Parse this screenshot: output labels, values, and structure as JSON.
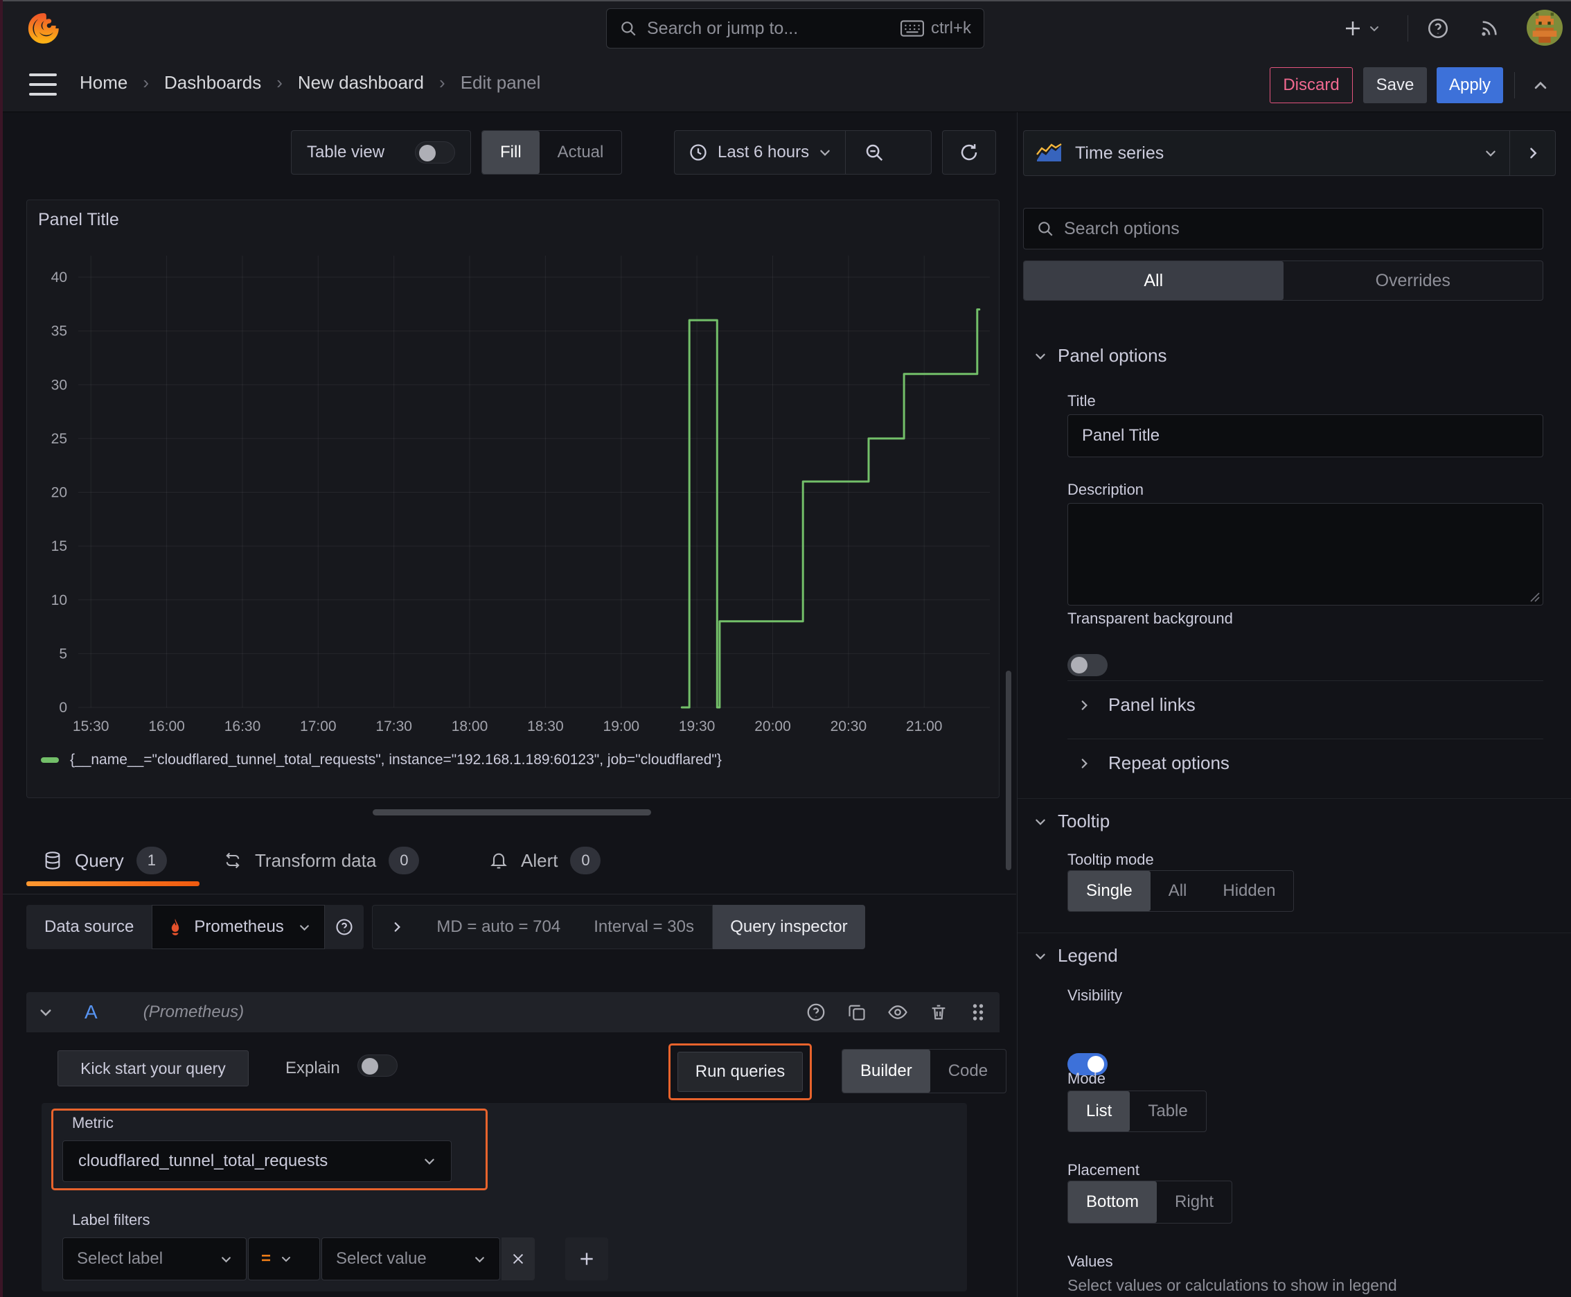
{
  "header": {
    "search_placeholder": "Search or jump to...",
    "search_shortcut": "ctrl+k"
  },
  "breadcrumb": {
    "items": [
      "Home",
      "Dashboards",
      "New dashboard"
    ],
    "current": "Edit panel",
    "discard": "Discard",
    "save": "Save",
    "apply": "Apply"
  },
  "toolbar": {
    "table_view": "Table view",
    "fill": "Fill",
    "actual": "Actual",
    "time_range": "Last 6 hours"
  },
  "panel": {
    "title": "Panel Title",
    "legend_label": "{__name__=\"cloudflared_tunnel_total_requests\", instance=\"192.168.1.189:60123\", job=\"cloudflared\"}"
  },
  "chart_data": {
    "type": "line",
    "line_style": "step-after",
    "title": "Panel Title",
    "x_ticks": [
      "15:30",
      "16:00",
      "16:30",
      "17:00",
      "17:30",
      "18:00",
      "18:30",
      "19:00",
      "19:30",
      "20:00",
      "20:30",
      "21:00"
    ],
    "y_ticks": [
      0,
      5,
      10,
      15,
      20,
      25,
      30,
      35,
      40
    ],
    "ylim": [
      0,
      42
    ],
    "x_range": [
      "15:25",
      "21:26"
    ],
    "grid": true,
    "legend_position": "bottom",
    "series": [
      {
        "name": "{__name__=\"cloudflared_tunnel_total_requests\", instance=\"192.168.1.189:60123\", job=\"cloudflared\"}",
        "color": "#73bf69",
        "points": [
          [
            "19:24",
            0
          ],
          [
            "19:27",
            36
          ],
          [
            "19:38",
            0
          ],
          [
            "19:39",
            8
          ],
          [
            "20:12",
            21
          ],
          [
            "20:38",
            25
          ],
          [
            "20:52",
            31
          ],
          [
            "21:21",
            37
          ]
        ]
      }
    ]
  },
  "tabs": {
    "query": "Query",
    "query_count": "1",
    "transform": "Transform data",
    "transform_count": "0",
    "alert": "Alert",
    "alert_count": "0"
  },
  "datasource": {
    "label": "Data source",
    "name": "Prometheus",
    "stats_md": "MD = auto = 704",
    "stats_interval": "Interval = 30s",
    "inspector": "Query inspector"
  },
  "query": {
    "ref_id": "A",
    "ds_hint": "(Prometheus)",
    "kickstart": "Kick start your query",
    "explain": "Explain",
    "run": "Run queries",
    "builder": "Builder",
    "code": "Code",
    "metric_label": "Metric",
    "metric_value": "cloudflared_tunnel_total_requests",
    "label_filters_label": "Label filters",
    "select_label": "Select label",
    "operator": "=",
    "select_value": "Select value"
  },
  "sidebar": {
    "viz_type": "Time series",
    "search_placeholder": "Search options",
    "tab_all": "All",
    "tab_overrides": "Overrides",
    "panel_options": {
      "heading": "Panel options",
      "title_label": "Title",
      "title_value": "Panel Title",
      "description_label": "Description",
      "transparent_label": "Transparent background"
    },
    "links": "Panel links",
    "repeat": "Repeat options",
    "tooltip": {
      "heading": "Tooltip",
      "mode_label": "Tooltip mode",
      "options": [
        "Single",
        "All",
        "Hidden"
      ]
    },
    "legend": {
      "heading": "Legend",
      "visibility_label": "Visibility",
      "mode_label": "Mode",
      "mode_options": [
        "List",
        "Table"
      ],
      "placement_label": "Placement",
      "placement_options": [
        "Bottom",
        "Right"
      ],
      "values_label": "Values",
      "values_hint": "Select values or calculations to show in legend"
    }
  },
  "colors": {
    "accent_orange": "#e8632c",
    "series_green": "#73bf69",
    "primary_blue": "#3d71d9",
    "discard_pink": "#e4547e"
  }
}
